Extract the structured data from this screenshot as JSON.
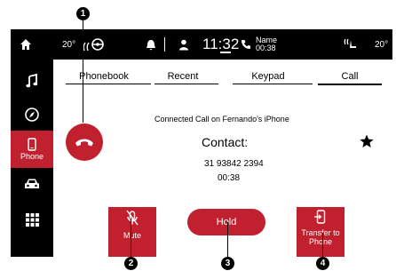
{
  "status_bar": {
    "temp_left": "20°",
    "time": "11:32",
    "call_name": "Name",
    "call_time": "00:38",
    "temp_right": "20°"
  },
  "sidebar": {
    "items": [
      {
        "icon": "home-icon",
        "label": ""
      },
      {
        "icon": "music-icon",
        "label": ""
      },
      {
        "icon": "compass-icon",
        "label": ""
      },
      {
        "icon": "phone-icon",
        "label": "Phone"
      },
      {
        "icon": "car-icon",
        "label": ""
      },
      {
        "icon": "apps-grid-icon",
        "label": ""
      }
    ]
  },
  "tabs": [
    "Phonebook",
    "Recent",
    "Keypad",
    "Call"
  ],
  "active_tab": "Call",
  "call": {
    "status": "Connected Call on Fernando's iPhone",
    "title": "Contact:",
    "number": "31 93842 2394",
    "duration": "00:38"
  },
  "buttons": {
    "mute": "Mute",
    "hold": "Hold",
    "transfer": "Transfer to Phone"
  },
  "callouts": [
    "1",
    "2",
    "3",
    "4"
  ],
  "colors": {
    "accent": "#c1202f",
    "bar": "#000000"
  }
}
